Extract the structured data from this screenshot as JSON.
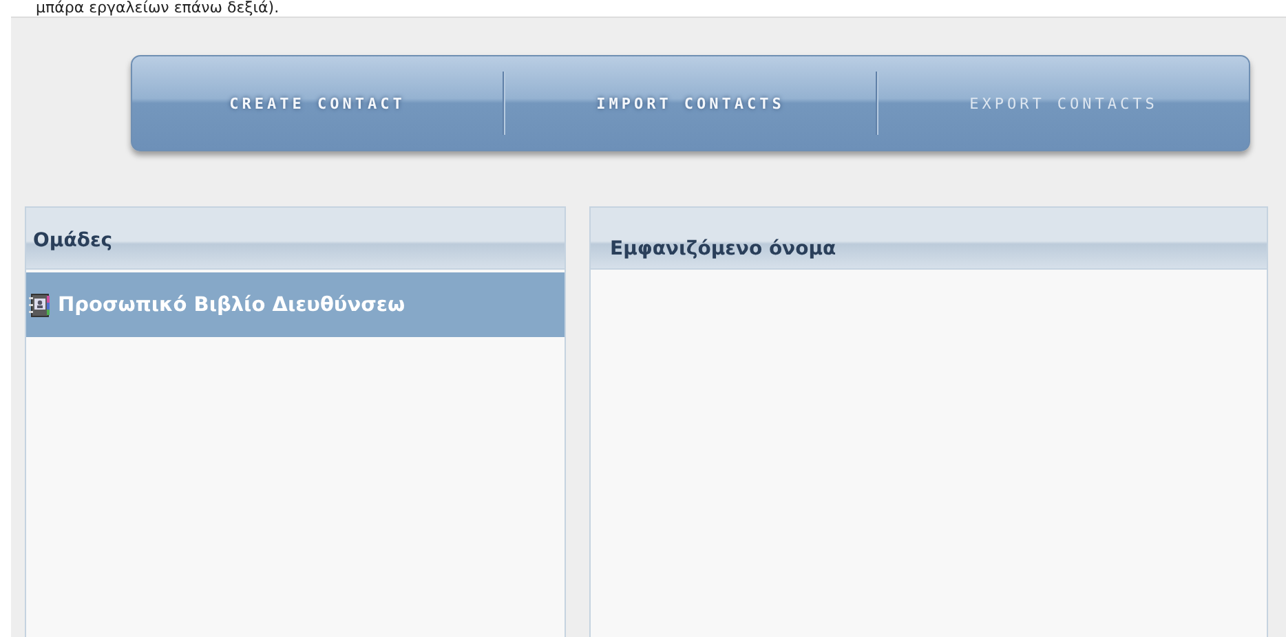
{
  "caption": "μπάρα εργαλείων επάνω δεξιά).",
  "toolbar": [
    {
      "label": "CREATE CONTACT",
      "disabled": false
    },
    {
      "label": "IMPORT CONTACTS",
      "disabled": false
    },
    {
      "label": "EXPORT CONTACTS",
      "disabled": true
    }
  ],
  "groups": {
    "header": "Ομάδες",
    "items": [
      {
        "label": "Προσωπικό Βιβλίο Διευθύνσεω",
        "selected": true
      }
    ]
  },
  "contacts": {
    "header": "Εμφανιζόμενο όνομα"
  }
}
